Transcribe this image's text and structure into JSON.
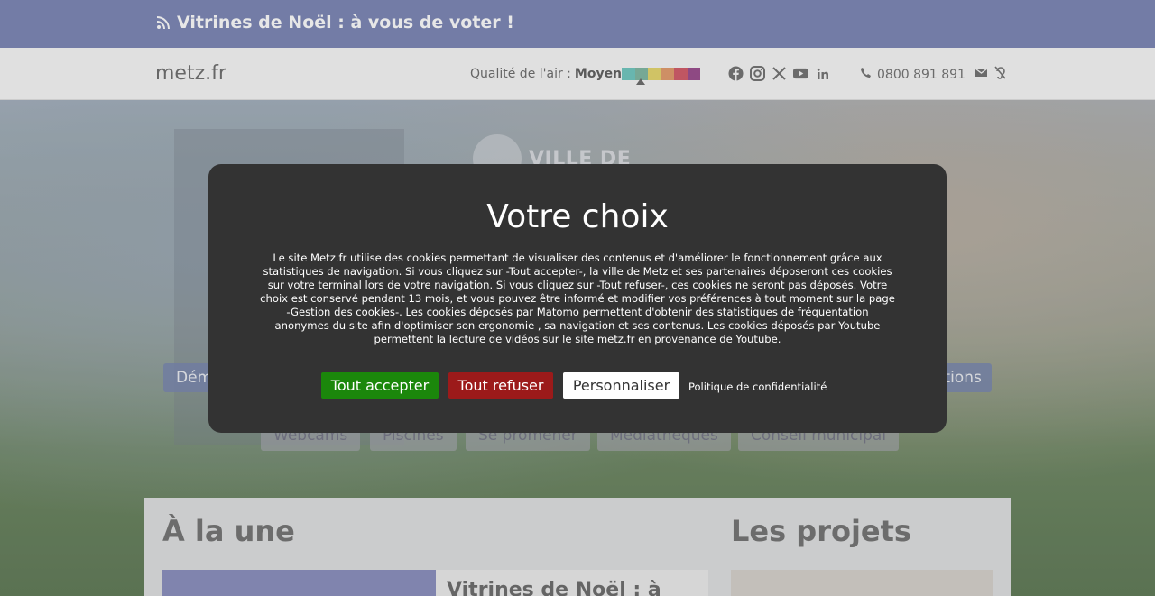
{
  "banner": {
    "text": "Vitrines de Noël : à vous de voter !",
    "icon": "rss-icon"
  },
  "header": {
    "brand": "metz.fr",
    "air_label": "Qualité de l'air :",
    "air_value": "Moyen",
    "air_colors": [
      "#6fc8c0",
      "#7fb8a2",
      "#e5d66c",
      "#e39b6b",
      "#d35b68",
      "#9a4c8e"
    ],
    "air_level": 0.2,
    "socials": [
      "facebook-icon",
      "instagram-icon",
      "x-icon",
      "youtube-icon",
      "linkedin-icon"
    ],
    "phone": "0800 891 891"
  },
  "hero": {
    "logo_text": "VILLE DE",
    "pills_row1_left": "Dém",
    "pills_row1_right": "ations",
    "quick_links": [
      "Webcams",
      "Piscines",
      "Se promener",
      "Médiathèques",
      "Conseil municipal"
    ]
  },
  "content": {
    "une_title": "À la une",
    "projects_title": "Les projets",
    "news_title": "Vitrines de Noël : à"
  },
  "cookie_modal": {
    "title": "Votre choix",
    "text": "Le site Metz.fr utilise des cookies permettant de visualiser des contenus et d'améliorer le fonctionnement grâce aux statistiques de navigation. Si vous cliquez sur -Tout accepter-, la ville de Metz et ses partenaires déposeront ces cookies sur votre terminal lors de votre navigation. Si vous cliquez sur -Tout refuser-, ces cookies ne seront pas déposés. Votre choix est conservé pendant 13 mois, et vous pouvez être informé et modifier vos préférences à tout moment sur la page -Gestion des cookies-. Les cookies déposés par Matomo permettent d'obtenir des statistiques de fréquentation anonymes du site afin d'optimiser son ergonomie , sa navigation et ses contenus. Les cookies déposés par Youtube permettent la lecture de vidéos sur le site metz.fr en provenance de Youtube.",
    "accept": "Tout accepter",
    "refuse": "Tout refuser",
    "customize": "Personnaliser",
    "policy": "Politique de confidentialité"
  }
}
